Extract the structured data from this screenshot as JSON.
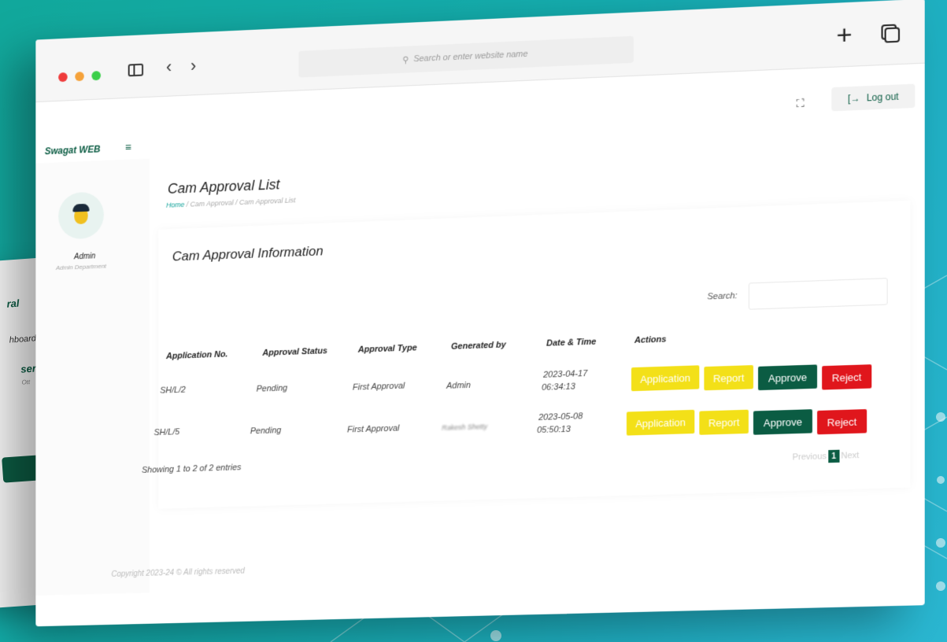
{
  "browser": {
    "url_placeholder": "Search or enter website name"
  },
  "header": {
    "brand": "Swagat WEB",
    "logout_label": "Log out"
  },
  "sidebar": {
    "user_name": "Admin",
    "user_dept": "Admin Department"
  },
  "page": {
    "title": "Cam Approval List",
    "breadcrumb": [
      "Home",
      "Cam Approval",
      "Cam Approval List"
    ]
  },
  "card": {
    "title": "Cam Approval Information",
    "search_label": "Search:",
    "columns": [
      "Application No.",
      "Approval Status",
      "Approval Type",
      "Generated by",
      "Date & Time",
      "Actions"
    ],
    "rows": [
      {
        "app_no": "SH/L/2",
        "status": "Pending",
        "type": "First Approval",
        "generated_by": "Admin",
        "date": "2023-04-17",
        "time": "06:34:13"
      },
      {
        "app_no": "SH/L/5",
        "status": "Pending",
        "type": "First Approval",
        "generated_by": "Rakesh Shetty",
        "date": "2023-05-08",
        "time": "05:50:13"
      }
    ],
    "actions": {
      "application": "Application",
      "report": "Report",
      "approve": "Approve",
      "reject": "Reject"
    },
    "showing": "Showing 1 to 2 of 2 entries",
    "pager": {
      "previous": "Previous",
      "page": "1",
      "next": "Next"
    }
  },
  "footer": "Copyright 2023-24 © All rights reserved",
  "backcard": {
    "items": [
      "ral",
      "hboard",
      "sers",
      "Ott"
    ]
  },
  "colors": {
    "accent": "#0b5c43",
    "teal": "#12a39a",
    "yellow": "#f3e018",
    "red": "#e0161c"
  }
}
